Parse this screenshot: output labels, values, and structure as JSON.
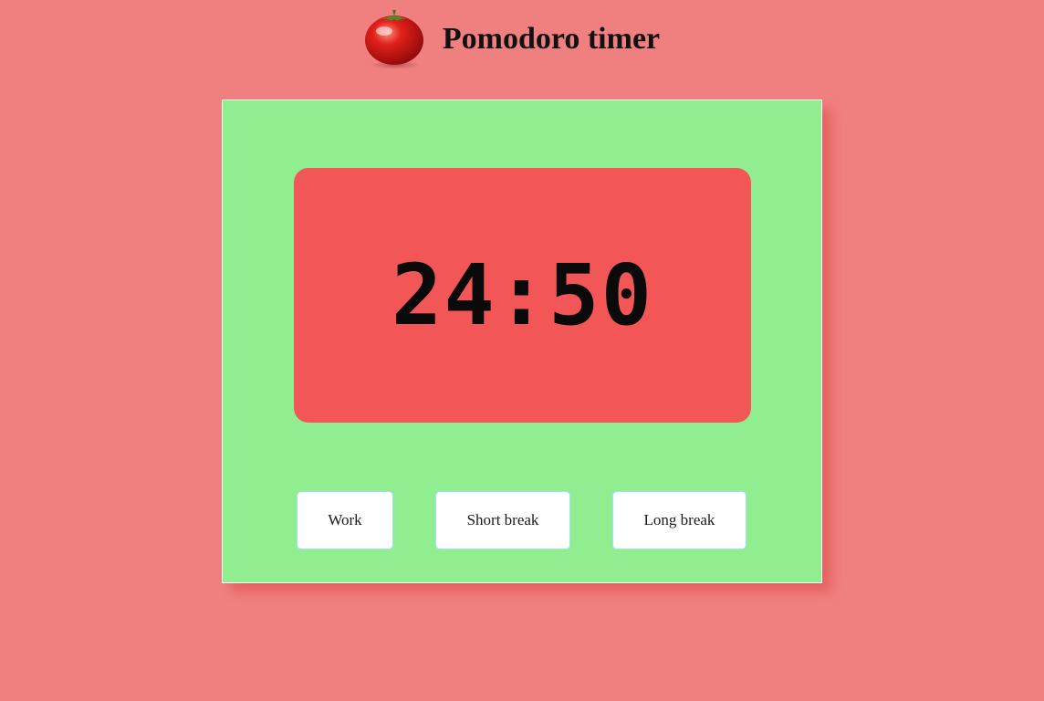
{
  "header": {
    "title": "Pomodoro timer",
    "logo_icon": "tomato-icon"
  },
  "timer": {
    "display": "24:50"
  },
  "modes": {
    "work_label": "Work",
    "short_break_label": "Short break",
    "long_break_label": "Long break"
  },
  "colors": {
    "page_background": "#f08080",
    "panel_background": "#90ee90",
    "display_background": "#f35656",
    "button_background": "#ffffff",
    "button_border": "#9fe3ef"
  }
}
